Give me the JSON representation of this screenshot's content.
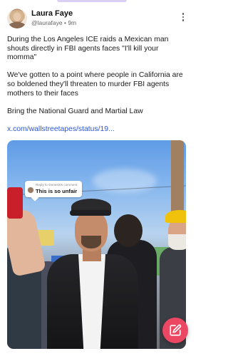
{
  "post": {
    "author_name": "Laura Faye",
    "handle": "@laurafaye",
    "time": "9m",
    "paragraphs": [
      "During the Los Angeles ICE raids a Mexican man shouts directly in FBI agents faces \"I'll kill your momma\"",
      "We've gotten to a point where people in California are so boldened they'll threaten to murder FBI agents mothers to their faces",
      "Bring the National Guard and Martial Law"
    ],
    "link_text": "x.com/wallstreetapes/status/19..."
  },
  "media": {
    "comment_reply_label": "Reply to Genesis's comment",
    "comment_text": "This is so unfair"
  },
  "icons": {
    "more": "vertical-dots-icon",
    "compose": "edit-icon"
  },
  "colors": {
    "link": "#2a57d6",
    "fab": "#ec4762",
    "indicator": "#d9d1f5"
  }
}
